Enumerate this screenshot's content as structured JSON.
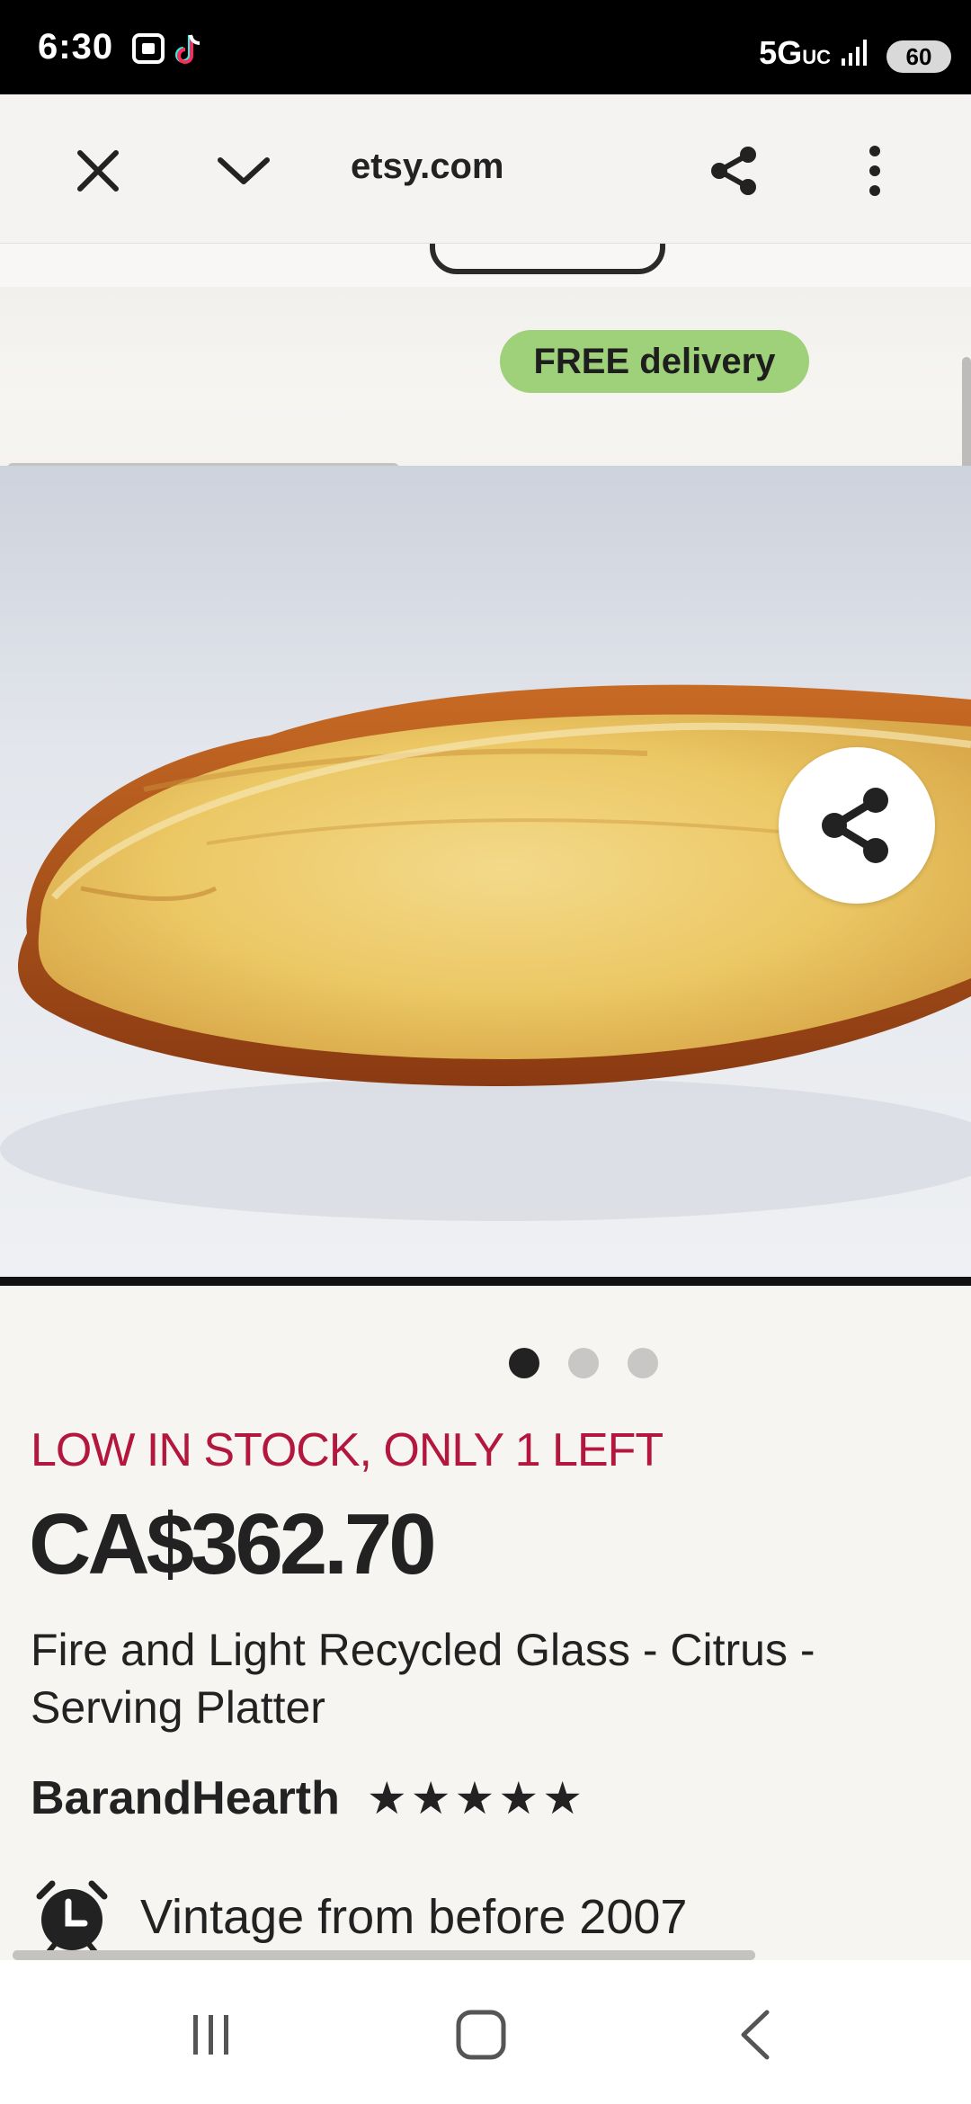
{
  "status_bar": {
    "time": "6:30",
    "network": "5G",
    "network_suffix": "UC",
    "battery": "60"
  },
  "browser": {
    "url": "etsy.com"
  },
  "banner": {
    "delivery_badge": "FREE delivery"
  },
  "carousel": {
    "total_dots": 3,
    "active_index": 0
  },
  "product": {
    "stock_notice": "LOW IN STOCK, ONLY 1 LEFT",
    "price": "CA$362.70",
    "title": "Fire and Light Recycled Glass - Citrus - Serving Platter",
    "shop_name": "BarandHearth",
    "rating_stars": 5,
    "vintage_note": "Vintage from before 2007"
  },
  "colors": {
    "stock_red": "#b3173d",
    "badge_green": "#9ed17a",
    "text_dark": "#222222"
  },
  "icons": {
    "close": "close-icon",
    "collapse": "chevron-down-icon",
    "share": "share-icon",
    "menu": "more-vert-icon",
    "alarm": "alarm-clock-icon",
    "nav_recents": "recents-icon",
    "nav_home": "home-icon",
    "nav_back": "back-icon"
  }
}
